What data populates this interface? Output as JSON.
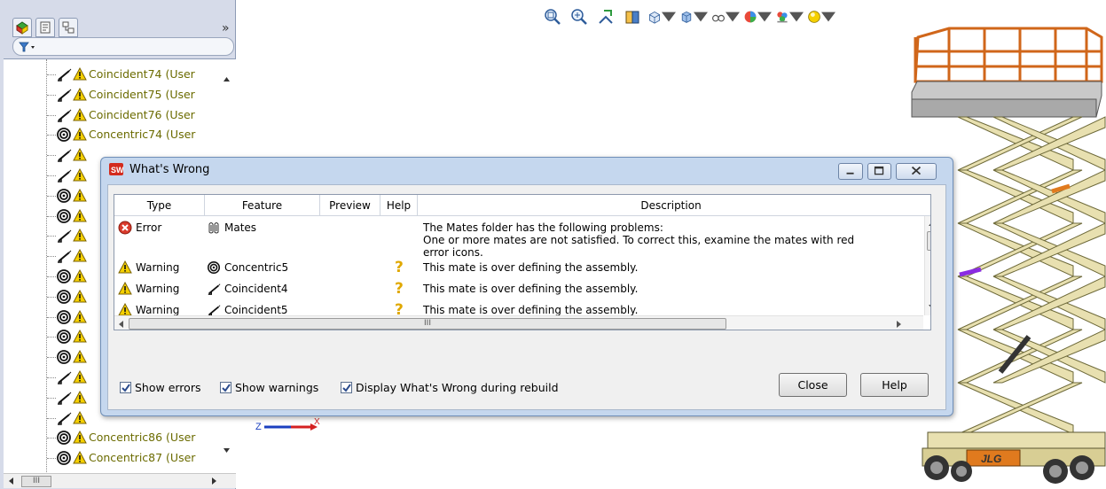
{
  "feature_tree": {
    "expand_symbol": "»",
    "rows": [
      {
        "icon": "coincident-mate-icon",
        "label": "Coincident74 (User"
      },
      {
        "icon": "coincident-mate-icon",
        "label": "Coincident75 (User"
      },
      {
        "icon": "coincident-mate-icon",
        "label": "Coincident76 (User"
      },
      {
        "icon": "concentric-mate-icon",
        "label": "Concentric74 (User"
      },
      {
        "icon": "coincident-mate-icon",
        "label": ""
      },
      {
        "icon": "coincident-mate-icon",
        "label": ""
      },
      {
        "icon": "concentric-mate-icon",
        "label": ""
      },
      {
        "icon": "concentric-mate-icon",
        "label": ""
      },
      {
        "icon": "coincident-mate-icon",
        "label": ""
      },
      {
        "icon": "coincident-mate-icon",
        "label": ""
      },
      {
        "icon": "concentric-mate-icon",
        "label": ""
      },
      {
        "icon": "concentric-mate-icon",
        "label": ""
      },
      {
        "icon": "concentric-mate-icon",
        "label": ""
      },
      {
        "icon": "concentric-mate-icon",
        "label": ""
      },
      {
        "icon": "concentric-mate-icon",
        "label": ""
      },
      {
        "icon": "coincident-mate-icon",
        "label": ""
      },
      {
        "icon": "coincident-mate-icon",
        "label": ""
      },
      {
        "icon": "coincident-mate-icon",
        "label": ""
      },
      {
        "icon": "concentric-mate-icon",
        "label": "Concentric86 (User"
      },
      {
        "icon": "concentric-mate-icon",
        "label": "Concentric87 (User"
      }
    ],
    "hscroll_grip": "III"
  },
  "toolbar": {
    "icons": [
      "zoom-to-fit-icon",
      "zoom-to-area-icon",
      "previous-view-icon",
      "section-view-icon",
      "view-orientation-icon",
      "display-style-icon",
      "hide-show-items-icon",
      "edit-appearance-icon",
      "apply-scene-icon",
      "view-settings-icon"
    ]
  },
  "triad": {
    "z_label": "Z",
    "x_label": "X"
  },
  "dialog": {
    "title": "What's Wrong",
    "columns": [
      "Type",
      "Feature",
      "Preview",
      "Help",
      "Description"
    ],
    "rows": [
      {
        "type": "Error",
        "type_icon": "error-icon",
        "feature": "Mates",
        "feature_icon": "mates-folder-icon",
        "help_icon": "",
        "description": [
          "The Mates folder has the following problems:",
          "One or more mates are not satisfied.  To correct this, examine the mates with red",
          "error icons."
        ]
      },
      {
        "type": "Warning",
        "type_icon": "warning-icon",
        "feature": "Concentric5",
        "feature_icon": "concentric-mate-icon",
        "help_icon": "help-question-icon",
        "description": [
          "This mate is over defining the assembly."
        ]
      },
      {
        "type": "Warning",
        "type_icon": "warning-icon",
        "feature": "Coincident4",
        "feature_icon": "coincident-mate-icon",
        "help_icon": "help-question-icon",
        "description": [
          "This mate is over defining the assembly."
        ]
      },
      {
        "type": "Warning",
        "type_icon": "warning-icon",
        "feature": "Coincident5",
        "feature_icon": "coincident-mate-icon",
        "help_icon": "help-question-icon",
        "description": [
          "This mate is over defining the assembly."
        ]
      }
    ],
    "hscroll_grip": "III",
    "options": [
      {
        "label": "Show errors",
        "checked": true
      },
      {
        "label": "Show warnings",
        "checked": true
      },
      {
        "label": "Display What's Wrong during rebuild",
        "checked": true
      }
    ],
    "close_label": "Close",
    "help_label": "Help"
  },
  "colors": {
    "tree_text": "#6b6b00",
    "warning_yellow": "#f5d000",
    "error_red": "#d93a2b",
    "lift_frame": "#e8e0b0",
    "lift_rail": "#e07a1e"
  }
}
